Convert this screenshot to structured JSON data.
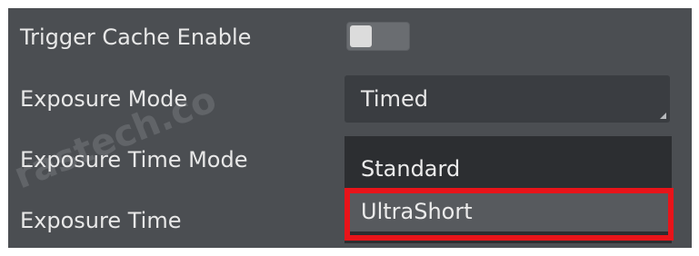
{
  "properties": [
    {
      "label": "Trigger Cache Enable"
    },
    {
      "label": "Exposure Mode"
    },
    {
      "label": "Exposure Time Mode"
    },
    {
      "label": "Exposure Time"
    }
  ],
  "trigger_cache_toggle": {
    "state": "off"
  },
  "exposure_mode_combo": {
    "value": "Timed"
  },
  "exposure_time_mode_dropdown": {
    "options": [
      "Standard",
      "UltraShort"
    ],
    "hovered": "UltraShort"
  },
  "watermark": {
    "text": "rastech.co"
  },
  "colors": {
    "panel_bg": "#4b4e52",
    "combo_bg": "#3a3d41",
    "dropdown_bg": "#2c2e31",
    "option_hover_bg": "#575a5e",
    "highlight_red": "#e8141a"
  }
}
